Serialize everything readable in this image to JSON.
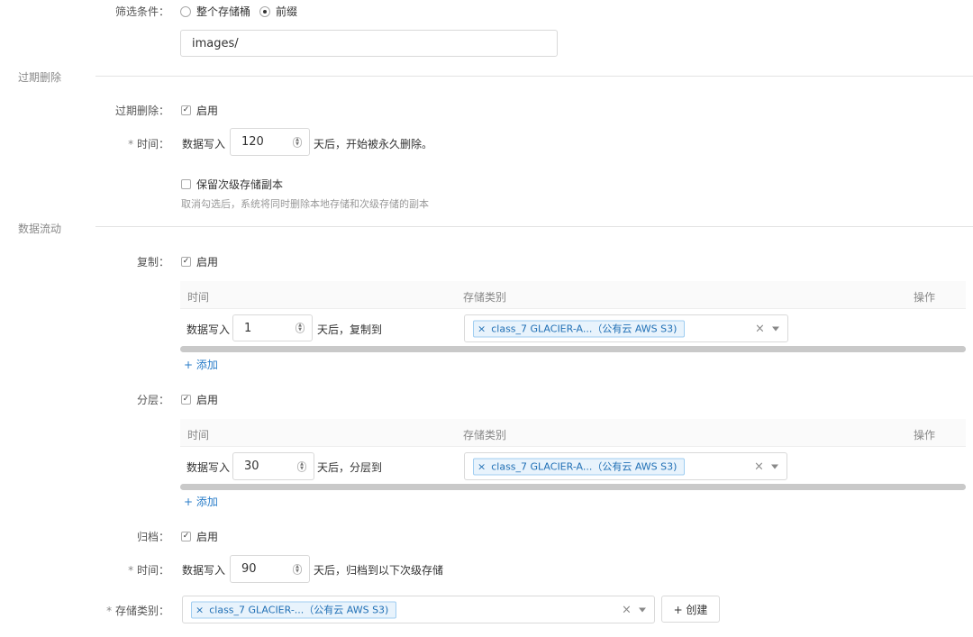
{
  "filter": {
    "label": "筛选条件：",
    "option_all": "整个存储桶",
    "option_prefix": "前缀",
    "prefix_value": "images/"
  },
  "expire_section": {
    "title": "过期删除",
    "enable_label": "过期删除：",
    "enable_text": "启用",
    "time_label": "时间：",
    "before": "数据写入",
    "days": "120",
    "after": "天后，开始被永久删除。",
    "keep_text": "保留次级存储副本",
    "hint": "取消勾选后，系统将同时删除本地存储和次级存储的副本"
  },
  "flow_section": {
    "title": "数据流动",
    "replication": {
      "label": "复制：",
      "enable_text": "启用",
      "col_time": "时间",
      "col_class": "存储类别",
      "col_action": "操作",
      "before": "数据写入",
      "days": "1",
      "after": "天后，复制到",
      "tag": "class_7 GLACIER-A...（公有云 AWS S3)",
      "add": "+ 添加"
    },
    "tiering": {
      "label": "分层：",
      "enable_text": "启用",
      "col_time": "时间",
      "col_class": "存储类别",
      "col_action": "操作",
      "before": "数据写入",
      "days": "30",
      "after": "天后，分层到",
      "tag": "class_7 GLACIER-A...（公有云 AWS S3)",
      "add": "+ 添加"
    },
    "archive": {
      "label": "归档：",
      "enable_text": "启用",
      "time_label": "时间：",
      "before": "数据写入",
      "days": "90",
      "after": "天后，归档到以下次级存储",
      "class_label": "存储类别：",
      "tag": "class_7 GLACIER-...（公有云 AWS S3)",
      "create": "+ 创建"
    }
  },
  "icons": {
    "check": "✓",
    "clear": "×",
    "tag_remove": "×",
    "spin_up": "▲",
    "spin_down": "▼"
  }
}
